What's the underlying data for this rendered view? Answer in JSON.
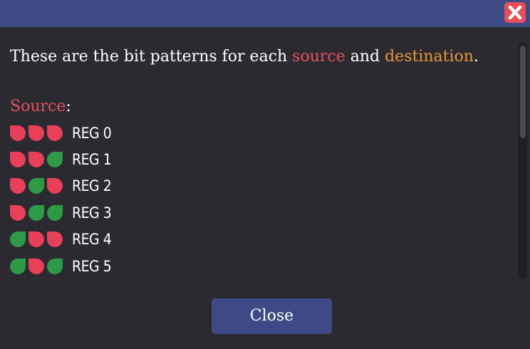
{
  "dialog": {
    "intro": {
      "before": "These are the bit patterns for each ",
      "source_word": "source",
      "middle": " and ",
      "destination_word": "destination",
      "after": "."
    },
    "source_heading": {
      "word": "Source",
      "colon": ":"
    },
    "registers": [
      {
        "label": "REG 0",
        "bits": [
          "off",
          "off",
          "off"
        ]
      },
      {
        "label": "REG 1",
        "bits": [
          "off",
          "off",
          "on"
        ]
      },
      {
        "label": "REG 2",
        "bits": [
          "off",
          "on",
          "off"
        ]
      },
      {
        "label": "REG 3",
        "bits": [
          "off",
          "on",
          "on"
        ]
      },
      {
        "label": "REG 4",
        "bits": [
          "on",
          "off",
          "off"
        ]
      },
      {
        "label": "REG 5",
        "bits": [
          "on",
          "off",
          "on"
        ]
      }
    ],
    "close_button_label": "Close"
  },
  "icons": {
    "window_close": "close-icon",
    "bit_off": "red-leaf-icon",
    "bit_on": "green-leaf-icon"
  },
  "colors": {
    "titlebar": "#3d4a85",
    "background": "#2b2a30",
    "source_accent": "#e8505f",
    "destination_accent": "#e8953a",
    "bit_off": "#e8405a",
    "bit_on": "#2e9a48",
    "close_x": "#e4505a"
  }
}
